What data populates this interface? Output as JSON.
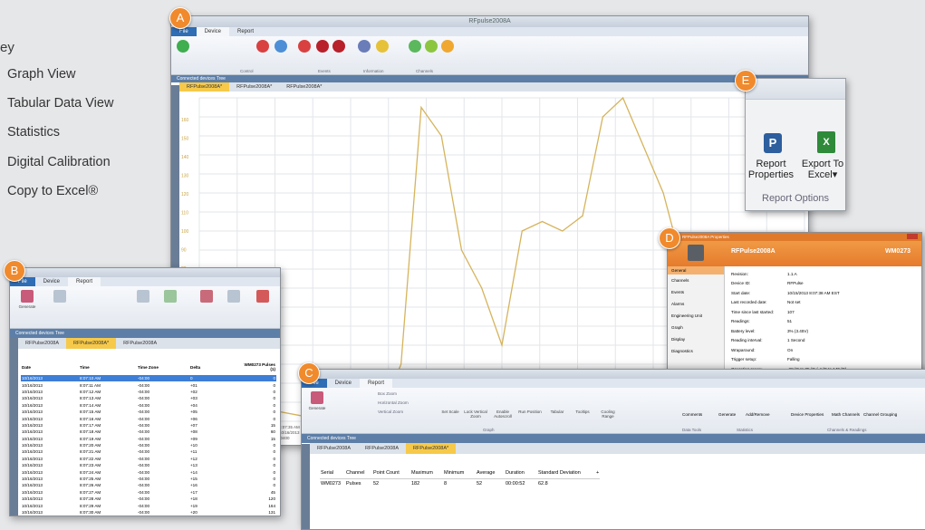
{
  "key": {
    "title": "ey",
    "items": [
      "Graph View",
      "Tabular Data View",
      "Statistics",
      "Digital Calibration",
      "Copy to Excel®"
    ]
  },
  "badges": {
    "a": "A",
    "b": "B",
    "c": "C",
    "d": "D",
    "e": "E"
  },
  "colors": {
    "badge": "#f08a2c",
    "file_tab": "#2f6db5",
    "active_tab": "#f6c94a",
    "chart_line": "#d6b45c"
  },
  "win_a": {
    "title": "RFpulse2008A",
    "tabs": [
      "File",
      "Device",
      "Report"
    ],
    "ribbon_groups": [
      "Control",
      "Events",
      "Information",
      "Channels"
    ],
    "connected_label": "Connected devices  Tree",
    "doc_tabs": [
      "RFPulse2008A*",
      "RFPulse2008A*",
      "RFPulse2008A*"
    ],
    "y_ticks": [
      "160",
      "150",
      "140",
      "130",
      "120",
      "110",
      "100",
      "90",
      "80",
      "70",
      "60",
      "50",
      "40",
      "30",
      "20",
      "10"
    ],
    "bottom_labels": [
      "8:07:35 AM",
      "10/16/2013",
      "-0400"
    ]
  },
  "chart_data": {
    "type": "line",
    "x": [
      0,
      1,
      2,
      3,
      4,
      5,
      6,
      7,
      8,
      9,
      10,
      11,
      12,
      13,
      14,
      15,
      16,
      17,
      18,
      19,
      20,
      21,
      22,
      23,
      24,
      25,
      26,
      27,
      28,
      29,
      30
    ],
    "series": [
      {
        "values": [
          8,
          10,
          60,
          20,
          5,
          3,
          4,
          6,
          3,
          4,
          30,
          165,
          150,
          90,
          70,
          40,
          100,
          105,
          100,
          108,
          160,
          170,
          145,
          120,
          80,
          40,
          20,
          10,
          5,
          3,
          2
        ]
      }
    ],
    "ylim": [
      0,
      170
    ]
  },
  "win_e": {
    "btn1_line1": "Report",
    "btn1_line2": "Properties",
    "btn2_line1": "Export To",
    "btn2_line2": "Excel",
    "group": "Report Options"
  },
  "win_d": {
    "title": "RFPulse2008A Properties",
    "device": "RFPulse2008A",
    "serial": "WM0273",
    "nav": [
      "General",
      "Channels",
      "Events",
      "Alarms",
      "Engineering Unit",
      "Graph",
      "Display",
      "Diagnostics"
    ],
    "fields": [
      [
        "Revision:",
        "1.1.A"
      ],
      [
        "Device ID:",
        "RFPulse"
      ],
      [
        "Start date:",
        "10/15/2013 8:07:38 AM EST"
      ],
      [
        "Last recorded date:",
        "Not set"
      ],
      [
        "Time since last started:",
        "107"
      ],
      [
        "Readings:",
        "51"
      ],
      [
        "Battery level:",
        "3%  (3.45V)"
      ],
      [
        "Reading interval:",
        "1 Second"
      ],
      [
        "Wraparound:",
        "On"
      ],
      [
        "Trigger setup:",
        "Falling"
      ],
      [
        "Operating range:",
        "-28 °C to 85 °C (-4 °F to 140 °F)"
      ]
    ],
    "ok": "OK"
  },
  "win_b": {
    "tabs": [
      "File",
      "Device",
      "Report"
    ],
    "generate": "Generate",
    "connected_label": "Connected devices  Tree",
    "doc_tabs": [
      "RFPulse2008A",
      "RFPulse2008A*",
      "RFPulse2008A"
    ],
    "headers": [
      "Date",
      "Time",
      "Time Zone",
      "Delta",
      "WM0273 Pulses (1)"
    ],
    "rows": [
      [
        "10/16/2013",
        "8:07:10 AM",
        "-04:00",
        "0",
        "0"
      ],
      [
        "10/16/2013",
        "8:07:11 AM",
        "-04:00",
        "+01",
        "0"
      ],
      [
        "10/16/2013",
        "8:07:12 AM",
        "-04:00",
        "+02",
        "0"
      ],
      [
        "10/16/2013",
        "8:07:13 AM",
        "-04:00",
        "+03",
        "0"
      ],
      [
        "10/16/2013",
        "8:07:14 AM",
        "-04:00",
        "+04",
        "0"
      ],
      [
        "10/16/2013",
        "8:07:15 AM",
        "-04:00",
        "+05",
        "0"
      ],
      [
        "10/16/2013",
        "8:07:16 AM",
        "-04:00",
        "+06",
        "0"
      ],
      [
        "10/16/2013",
        "8:07:17 AM",
        "-04:00",
        "+07",
        "15"
      ],
      [
        "10/16/2013",
        "8:07:18 AM",
        "-04:00",
        "+08",
        "60"
      ],
      [
        "10/16/2013",
        "8:07:19 AM",
        "-04:00",
        "+09",
        "15"
      ],
      [
        "10/16/2013",
        "8:07:20 AM",
        "-04:00",
        "+10",
        "0"
      ],
      [
        "10/16/2013",
        "8:07:21 AM",
        "-04:00",
        "+11",
        "0"
      ],
      [
        "10/16/2013",
        "8:07:22 AM",
        "-04:00",
        "+12",
        "0"
      ],
      [
        "10/16/2013",
        "8:07:23 AM",
        "-04:00",
        "+13",
        "0"
      ],
      [
        "10/16/2013",
        "8:07:24 AM",
        "-04:00",
        "+14",
        "0"
      ],
      [
        "10/16/2013",
        "8:07:25 AM",
        "-04:00",
        "+15",
        "0"
      ],
      [
        "10/16/2013",
        "8:07:26 AM",
        "-04:00",
        "+16",
        "0"
      ],
      [
        "10/16/2013",
        "8:07:27 AM",
        "-04:00",
        "+17",
        "45"
      ],
      [
        "10/16/2013",
        "8:07:28 AM",
        "-04:00",
        "+18",
        "120"
      ],
      [
        "10/16/2013",
        "8:07:29 AM",
        "-04:00",
        "+19",
        "164"
      ],
      [
        "10/16/2013",
        "8:07:30 AM",
        "-04:00",
        "+20",
        "131"
      ],
      [
        "10/16/2013",
        "8:07:31 AM",
        "-04:00",
        "+21",
        "75"
      ]
    ]
  },
  "win_c": {
    "tabs": [
      "File",
      "Device",
      "Report"
    ],
    "generate": "Generate",
    "ribbon_mid": [
      "Set Scale",
      "Lock Vertical Zoom",
      "Enable Autoscroll",
      "Run Position",
      "Tabular",
      "Tooltips",
      "Cooling Range"
    ],
    "zoom_items": [
      "Box Zoom",
      "Horizontal Zoom",
      "Vertical Zoom"
    ],
    "right_btns": [
      "Comments",
      "Generate",
      "Add/Remove",
      "Device Properties",
      "Math Channels",
      "Channel Grouping"
    ],
    "groups": [
      "Graph",
      "Data Tools",
      "Statistics",
      "Channels & Readings"
    ],
    "connected_label": "Connected devices  Tree",
    "doc_tabs": [
      "RFPulse2008A",
      "RFPulse2008A",
      "RFPulse2008A*"
    ],
    "headers": [
      "Serial",
      "Channel",
      "Point Count",
      "Maximum",
      "Minimum",
      "Average",
      "Duration",
      "Standard Deviation",
      "+"
    ],
    "row": [
      "WM0273",
      "Pulses",
      "52",
      "182",
      "8",
      "52",
      "00:00:52",
      "62.8"
    ]
  }
}
